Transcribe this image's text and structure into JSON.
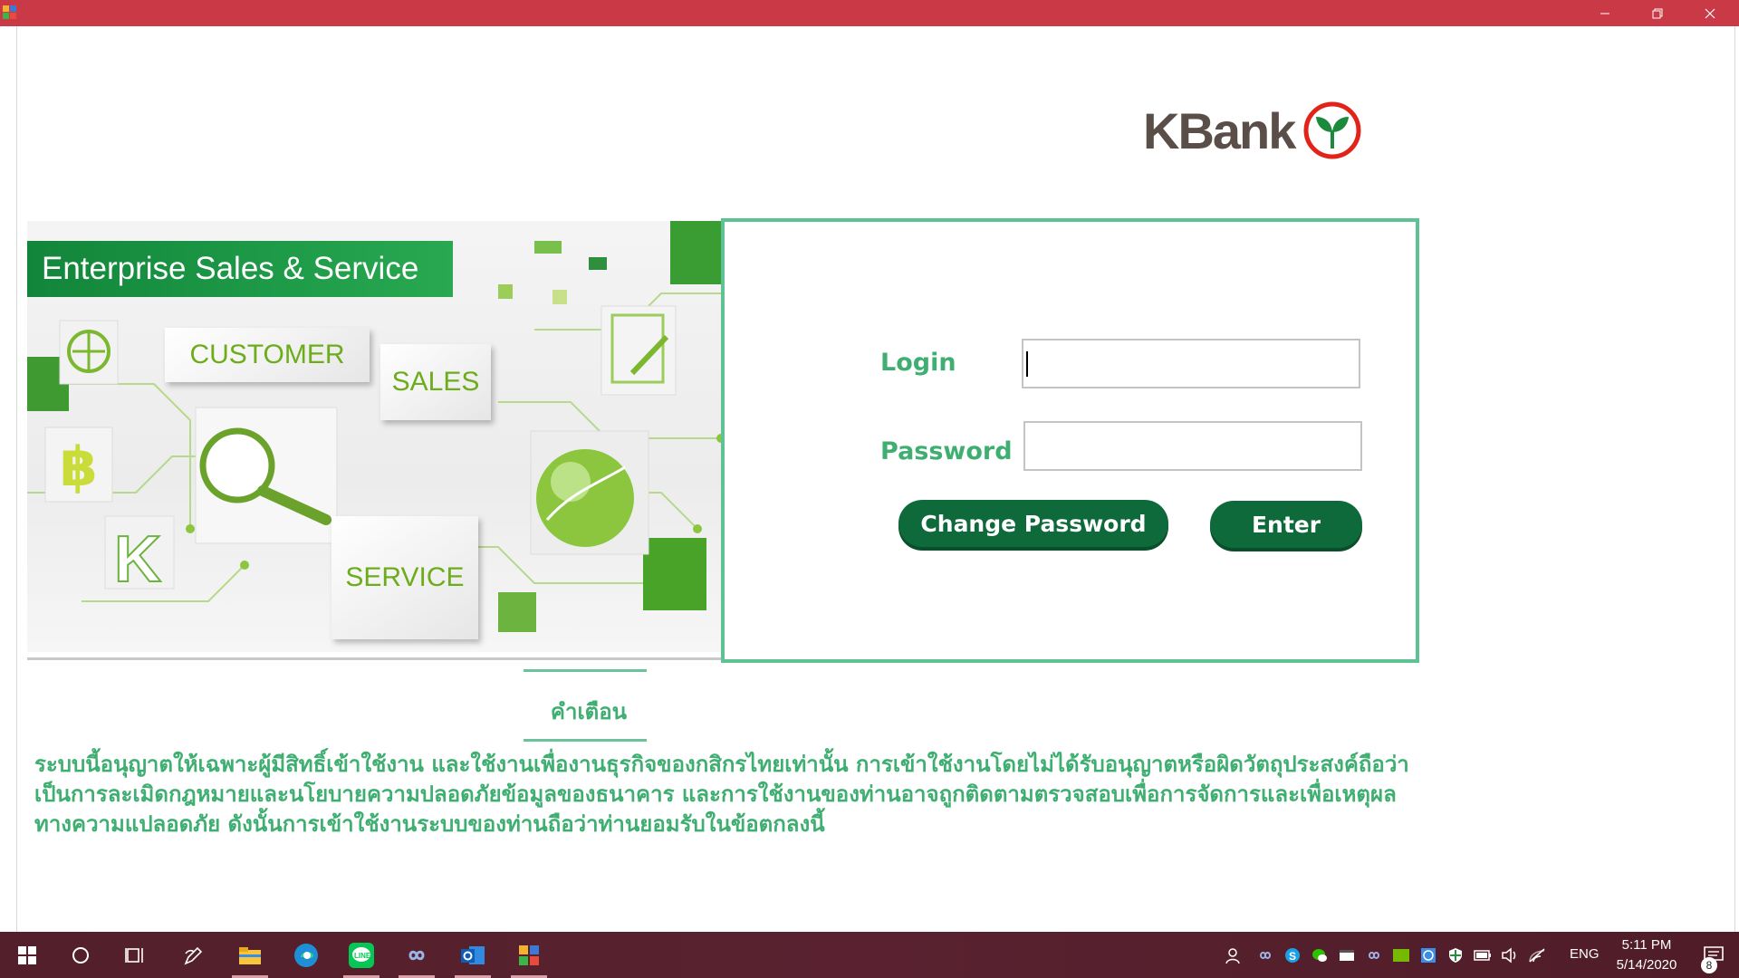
{
  "window": {
    "controls": [
      "minimize",
      "restore",
      "close"
    ]
  },
  "logo": {
    "text": "KBank"
  },
  "banner": {
    "title": "Enterprise Sales & Service",
    "tiles": [
      "CUSTOMER",
      "SALES",
      "SERVICE"
    ]
  },
  "login": {
    "login_label": "Login",
    "password_label": "Password",
    "login_value": "",
    "password_value": "",
    "change_password_label": "Change Password",
    "enter_label": "Enter"
  },
  "warning": {
    "title": "คำเตือน",
    "text": "ระบบนี้อนุญาตให้เฉพาะผู้มีสิทธิ์เข้าใช้งาน และใช้งานเพื่องานธุรกิจของกสิกรไทยเท่านั้น การเข้าใช้งานโดยไม่ได้รับอนุญาตหรือผิดวัตถุประสงค์ถือว่าเป็นการละเมิดกฎหมายและนโยบายความปลอดภัยข้อมูลของธนาคาร และการใช้งานของท่านอาจถูกติดตามตรวจสอบเพื่อการจัดการและเพื่อเหตุผลทางความแปลอดภัย ดังนั้นการเข้าใช้งานระบบของท่านถือว่าท่านยอมรับในข้อตกลงนี้"
  },
  "colors": {
    "accent": "#3fae71",
    "button": "#0f6a3b",
    "titlebar": "#c93a46",
    "border": "#5ec295"
  },
  "taskbar": {
    "apps": [
      "start-icon",
      "search-icon",
      "task-view-icon",
      "pen-icon",
      "file-explorer-icon",
      "edge-icon",
      "line-icon",
      "app-infinity-icon",
      "outlook-icon",
      "app-window-icon"
    ],
    "language": "ENG",
    "time": "5:11 PM",
    "date": "5/14/2020",
    "notification_count": "8"
  }
}
